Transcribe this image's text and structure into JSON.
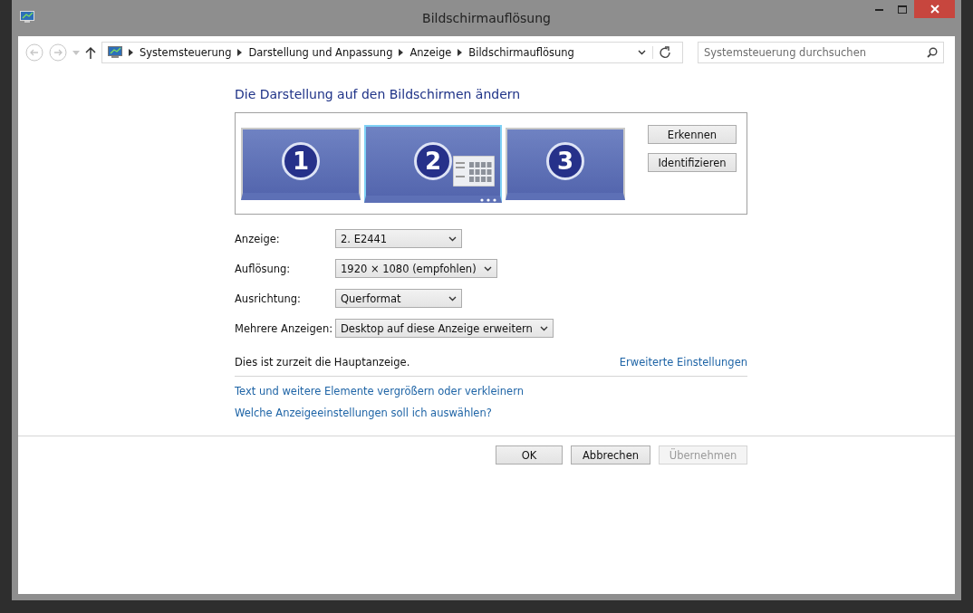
{
  "window": {
    "title": "Bildschirmauflösung"
  },
  "breadcrumb": [
    "Systemsteuerung",
    "Darstellung und Anpassung",
    "Anzeige",
    "Bildschirmauflösung"
  ],
  "search": {
    "placeholder": "Systemsteuerung durchsuchen"
  },
  "heading": "Die Darstellung auf den Bildschirmen ändern",
  "monitors": [
    {
      "label": "1",
      "selected": false,
      "primary": false
    },
    {
      "label": "2",
      "selected": true,
      "primary": true
    },
    {
      "label": "3",
      "selected": false,
      "primary": false
    }
  ],
  "side_buttons": [
    "Erkennen",
    "Identifizieren"
  ],
  "settings": [
    {
      "label": "Anzeige:",
      "value": "2. E2441"
    },
    {
      "label": "Auflösung:",
      "value": "1920 × 1080 (empfohlen)"
    },
    {
      "label": "Ausrichtung:",
      "value": "Querformat"
    },
    {
      "label": "Mehrere Anzeigen:",
      "value": "Desktop auf diese Anzeige erweitern"
    }
  ],
  "primary_note": "Dies ist zurzeit die Hauptanzeige.",
  "advanced_link": "Erweiterte Einstellungen",
  "links": [
    "Text und weitere Elemente vergrößern oder verkleinern",
    "Welche Anzeigeeinstellungen soll ich auswählen?"
  ],
  "buttons": [
    {
      "label": "OK",
      "disabled": false
    },
    {
      "label": "Abbrechen",
      "disabled": false
    },
    {
      "label": "Übernehmen",
      "disabled": true
    }
  ]
}
